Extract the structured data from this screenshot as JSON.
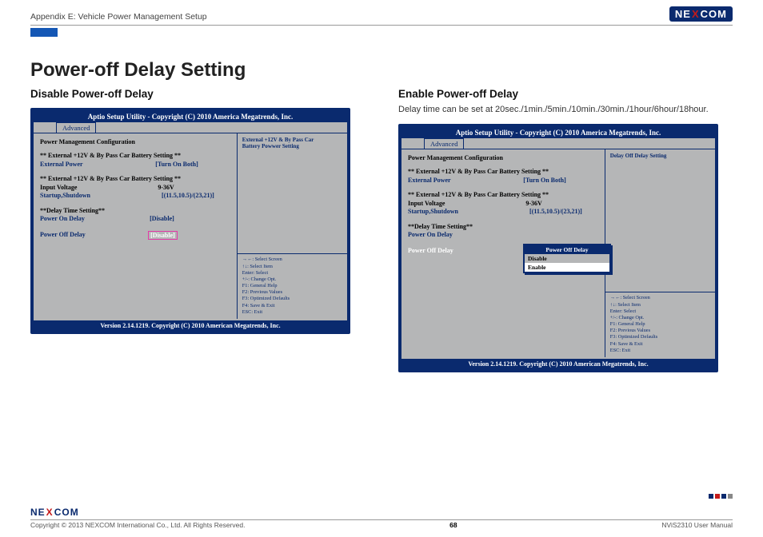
{
  "header": {
    "breadcrumb": "Appendix E: Vehicle Power Management Setup",
    "brand_pre": "NE",
    "brand_x": "X",
    "brand_post": "COM"
  },
  "title": "Power-off Delay Setting",
  "colA": {
    "heading": "Disable Power-off Delay"
  },
  "colB": {
    "heading": "Enable Power-off Delay",
    "desc": "Delay time can be set at 20sec./1min./5min./10min./30min./1hour/6hour/18hour."
  },
  "bios": {
    "title": "Aptio Setup Utility - Copyright (C) 2010 America Megatrends, Inc.",
    "tab": "Advanced",
    "footer": "Version 2.14.1219. Copyright (C) 2010 American Megatrends, Inc.",
    "pm_heading": "Power Management Configuration",
    "sec1": "** External +12V & By Pass Car Battery Setting **",
    "ext_power_label": "External Power",
    "ext_power_val": "[Turn On Both]",
    "sec2": "** External +12V & By Pass Car Battery Setting **",
    "input_voltage_label": "Input Voltage",
    "input_voltage_val": "9-36V",
    "startup_label": "Startup,Shutdown",
    "startup_val": "[(11.5,10.5)/(23,21)]",
    "delay_heading": "**Delay Time Setting**",
    "pon_label": "Power On Delay",
    "pon_val": "[Disable]",
    "poff_label": "Power Off Delay",
    "poff_val_selected": "[Disable]"
  },
  "side1": {
    "line1": "External +12V & By Pass Car",
    "line2": "Battery Powwer Setting"
  },
  "side2": {
    "line1": "Delay Off Delay Setting"
  },
  "help": {
    "l1": "→←: Select Screen",
    "l2": "↑↓: Select Item",
    "l3": "Enter: Select",
    "l4": "+/-: Change Opt.",
    "l5": "F1: General Help",
    "l6": "F2: Previous Values",
    "l7": "F3: Optimized Defaults",
    "l8": "F4: Save & Exit",
    "l9": "ESC: Exit"
  },
  "popup": {
    "title": "Power Off Delay",
    "opt1": "Disable",
    "opt2": "Enable"
  },
  "footer": {
    "copyright": "Copyright © 2013 NEXCOM International Co., Ltd. All Rights Reserved.",
    "page": "68",
    "doc": "NViS2310 User Manual"
  }
}
